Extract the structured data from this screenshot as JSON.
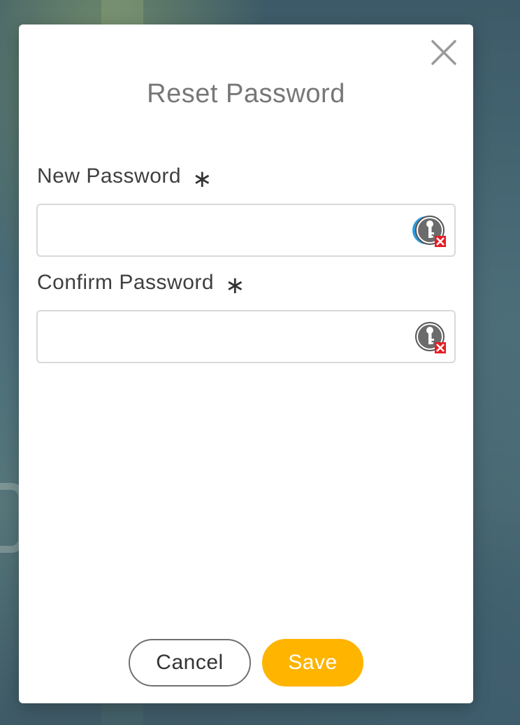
{
  "dialog": {
    "title": "Reset Password",
    "close_icon": "close-icon"
  },
  "fields": {
    "new_password": {
      "label": "New Password",
      "required_marker": "∗",
      "value": "",
      "placeholder": "",
      "icon": "password-manager-key-icon"
    },
    "confirm_password": {
      "label": "Confirm Password",
      "required_marker": "∗",
      "value": "",
      "placeholder": "",
      "icon": "password-manager-key-icon"
    }
  },
  "actions": {
    "cancel_label": "Cancel",
    "save_label": "Save"
  },
  "colors": {
    "accent": "#ffb400",
    "title": "#777777",
    "badge_error": "#e41e26"
  }
}
